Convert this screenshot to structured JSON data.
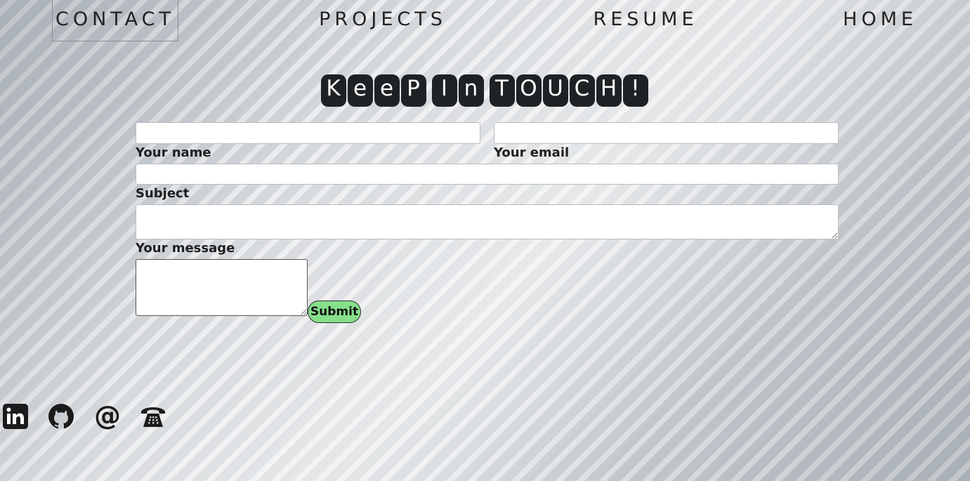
{
  "nav": {
    "items": [
      {
        "label": "CONTACT",
        "active": true
      },
      {
        "label": "PROJECTS",
        "active": false
      },
      {
        "label": "RESUME",
        "active": false
      },
      {
        "label": "HOME",
        "active": false
      }
    ]
  },
  "title": {
    "words": [
      [
        "K",
        "e",
        "e",
        "P"
      ],
      [
        "I",
        "n"
      ],
      [
        "T",
        "O",
        "U",
        "C",
        "H",
        "!"
      ]
    ],
    "text": "Keep In Touch!"
  },
  "form": {
    "name_label": "Your name",
    "name_value": "",
    "email_label": "Your email",
    "email_value": "",
    "subject_label": "Subject",
    "subject_value": "",
    "message_label": "Your message",
    "message_value": "",
    "submit_label": "Submit"
  },
  "social": {
    "icons": [
      "linkedin-icon",
      "github-icon",
      "at-sign-icon",
      "telephone-icon"
    ]
  },
  "colors": {
    "submit_bg": "#86e08a",
    "title_tile": "#1f2224"
  }
}
